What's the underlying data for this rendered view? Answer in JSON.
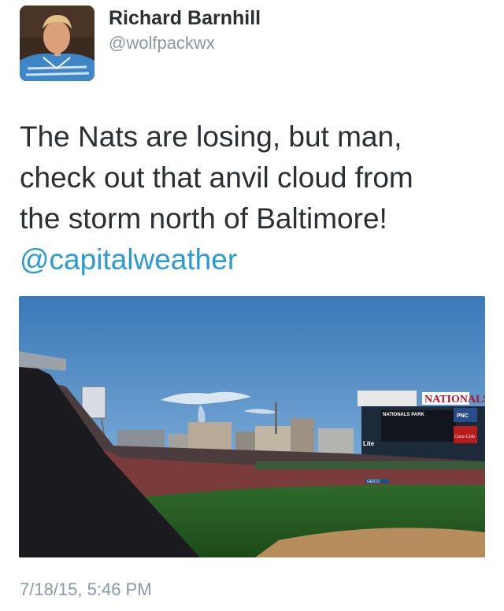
{
  "author": {
    "name": "Richard Barnhill",
    "handle": "@wolfpackwx"
  },
  "tweet": {
    "lines": [
      "The Nats are losing, but man,",
      "check out that anvil cloud from",
      "the storm north of Baltimore!"
    ],
    "mention": "@capitalweather",
    "timestamp": "7/18/15, 5:46 PM"
  },
  "photo": {
    "stadium_sign": "NATIONALS",
    "park_sign": "NATIONALS PARK",
    "pnc_sign": "PNC",
    "lite_sign": "Lite",
    "coke_sign": "Coca-Cola",
    "geico_sign": "GEICO"
  },
  "colors": {
    "mention": "#2b9ad5",
    "secondary_text": "#8899a6",
    "primary_text": "#292f33"
  }
}
